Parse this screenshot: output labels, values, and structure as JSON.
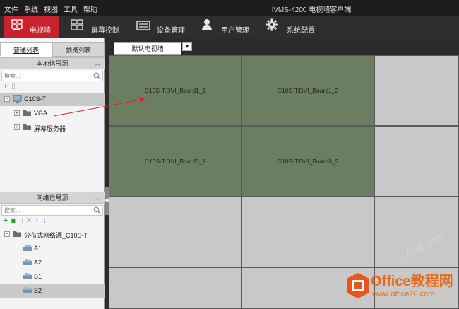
{
  "menubar": {
    "items": [
      "文件",
      "系统",
      "视图",
      "工具",
      "帮助"
    ],
    "title": "iVMS-4200 电视墙客户端"
  },
  "nav": {
    "items": [
      {
        "label": "电视墙",
        "icon": "tv-wall-icon",
        "active": true
      },
      {
        "label": "屏幕控制",
        "icon": "grid-icon",
        "active": false
      },
      {
        "label": "设备管理",
        "icon": "device-icon",
        "active": false
      },
      {
        "label": "用户管理",
        "icon": "user-icon",
        "active": false
      },
      {
        "label": "系统配置",
        "icon": "gear-icon",
        "active": false
      }
    ],
    "active_color": "#c8232c"
  },
  "left": {
    "tabs": [
      "普通列表",
      "预览列表"
    ],
    "local_section": {
      "title": "本地信号源",
      "search_placeholder": "搜索...",
      "tree": [
        {
          "label": "C10S-T",
          "level": 0,
          "expander": "-",
          "icon": "monitor-icon"
        },
        {
          "label": "VGA",
          "level": 1,
          "expander": "+",
          "icon": "folder-icon"
        },
        {
          "label": "屏幕服务器",
          "level": 1,
          "expander": "+",
          "icon": "folder-icon"
        }
      ]
    },
    "network_section": {
      "title": "网络信号源",
      "search_placeholder": "搜索...",
      "tree": [
        {
          "label": "分布式网络源_C10S-T",
          "level": 0,
          "expander": "-",
          "icon": "folder-icon"
        },
        {
          "label": "A1",
          "level": 1,
          "icon": "camera-group-icon"
        },
        {
          "label": "A2",
          "level": 1,
          "icon": "camera-group-icon"
        },
        {
          "label": "B1",
          "level": 1,
          "icon": "camera-group-icon"
        },
        {
          "label": "B2",
          "level": 1,
          "icon": "camera-group-icon",
          "selected": true
        }
      ]
    }
  },
  "wall": {
    "selected": "默认电视墙",
    "cells": [
      {
        "label": "C10S-T:DVI_Board1_1",
        "active": true
      },
      {
        "label": "C10S-T:DVI_Board1_2",
        "active": true
      },
      {
        "label": "",
        "active": false
      },
      {
        "label": "C10S-T:DVI_Board3_1",
        "active": true
      },
      {
        "label": "C10S-T:DVI_Board3_2",
        "active": true
      },
      {
        "label": "",
        "active": false
      },
      {
        "label": "",
        "active": false
      },
      {
        "label": "",
        "active": false
      },
      {
        "label": "",
        "active": false
      },
      {
        "label": "",
        "active": false
      },
      {
        "label": "",
        "active": false
      },
      {
        "label": "",
        "active": false
      }
    ],
    "active_color": "#6c7e62"
  },
  "watermark": {
    "brand": "Office教程网",
    "url": "www.office26.com",
    "faint": "八分网 .com"
  }
}
